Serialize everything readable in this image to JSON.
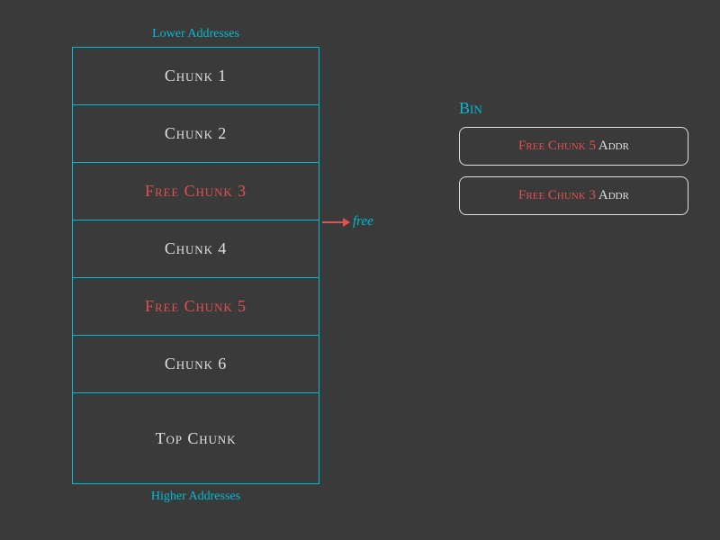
{
  "lower_address_label": "Lower Addresses",
  "higher_address_label": "Higher Addresses",
  "chunks": [
    {
      "id": "chunk1",
      "label": "Chunk 1",
      "type": "normal"
    },
    {
      "id": "chunk2",
      "label": "Chunk 2",
      "type": "normal"
    },
    {
      "id": "chunk3",
      "label": "Free Chunk 3",
      "type": "free"
    },
    {
      "id": "chunk4",
      "label": "Chunk 4",
      "type": "normal"
    },
    {
      "id": "chunk5",
      "label": "Free Chunk 5",
      "type": "free"
    },
    {
      "id": "chunk6",
      "label": "Chunk 6",
      "type": "normal"
    },
    {
      "id": "topchunk",
      "label": "Top Chunk",
      "type": "normal",
      "tall": true
    }
  ],
  "arrow_label": "free",
  "bin": {
    "label": "Bin",
    "items": [
      {
        "id": "bin-item1",
        "free_text": "Free Chunk 5",
        "addr_text": "Addr"
      },
      {
        "id": "bin-item2",
        "free_text": "Free Chunk 3",
        "addr_text": "Addr"
      }
    ]
  }
}
